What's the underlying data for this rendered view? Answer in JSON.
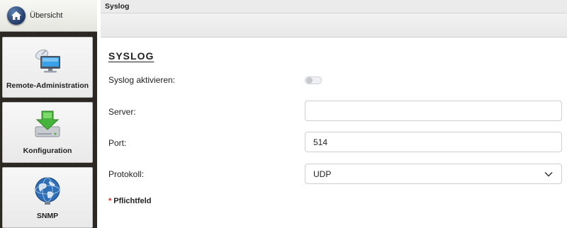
{
  "sidebar": {
    "overview": {
      "label": "Übersicht",
      "icon": "home-icon"
    },
    "tiles": [
      {
        "label": "Remote-Administration",
        "icon": "monitor-satellite-icon"
      },
      {
        "label": "Konfiguration",
        "icon": "download-drive-icon"
      },
      {
        "label": "SNMP",
        "icon": "globe-icon"
      }
    ]
  },
  "main": {
    "header_title": "Syslog",
    "section_title": "SYSLOG",
    "form": {
      "syslog_enable": {
        "label": "Syslog aktivieren:",
        "enabled": false
      },
      "server": {
        "label": "Server:",
        "value": ""
      },
      "port": {
        "label": "Port:",
        "value": "514"
      },
      "protocol": {
        "label": "Protokoll:",
        "value": "UDP"
      }
    },
    "required_note": {
      "star": "*",
      "text": "Pflichtfeld"
    }
  },
  "colors": {
    "required_star": "#dd2222",
    "sidebar_bg": "#2a2520"
  }
}
